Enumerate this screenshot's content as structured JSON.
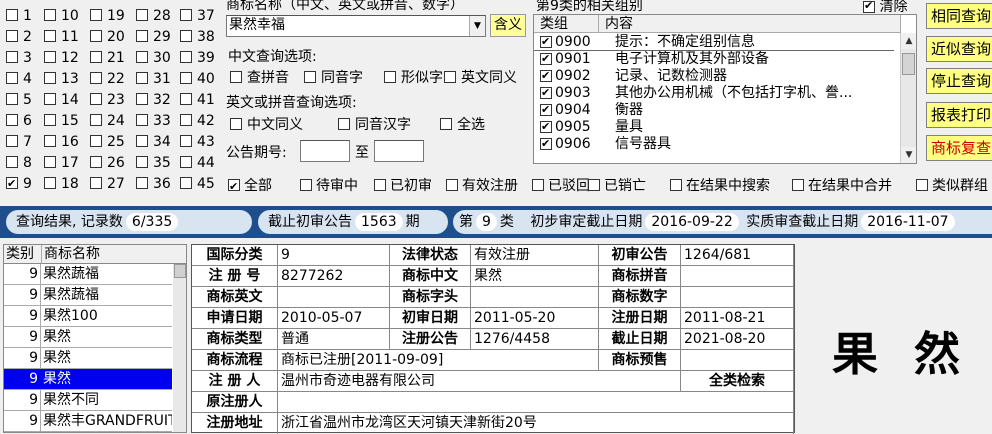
{
  "class_grid": {
    "columns": [
      [
        {
          "n": "1",
          "c": false
        },
        {
          "n": "2",
          "c": false
        },
        {
          "n": "3",
          "c": false
        },
        {
          "n": "4",
          "c": false
        },
        {
          "n": "5",
          "c": false
        },
        {
          "n": "6",
          "c": false
        },
        {
          "n": "7",
          "c": false
        },
        {
          "n": "8",
          "c": false
        },
        {
          "n": "9",
          "c": true
        }
      ],
      [
        {
          "n": "10",
          "c": false
        },
        {
          "n": "11",
          "c": false
        },
        {
          "n": "12",
          "c": false
        },
        {
          "n": "13",
          "c": false
        },
        {
          "n": "14",
          "c": false
        },
        {
          "n": "15",
          "c": false
        },
        {
          "n": "16",
          "c": false
        },
        {
          "n": "17",
          "c": false
        },
        {
          "n": "18",
          "c": false
        }
      ],
      [
        {
          "n": "19",
          "c": false
        },
        {
          "n": "20",
          "c": false
        },
        {
          "n": "21",
          "c": false
        },
        {
          "n": "22",
          "c": false
        },
        {
          "n": "23",
          "c": false
        },
        {
          "n": "24",
          "c": false
        },
        {
          "n": "25",
          "c": false
        },
        {
          "n": "26",
          "c": false
        },
        {
          "n": "27",
          "c": false
        }
      ],
      [
        {
          "n": "28",
          "c": false
        },
        {
          "n": "29",
          "c": false
        },
        {
          "n": "30",
          "c": false
        },
        {
          "n": "31",
          "c": false
        },
        {
          "n": "32",
          "c": false
        },
        {
          "n": "33",
          "c": false
        },
        {
          "n": "34",
          "c": false
        },
        {
          "n": "35",
          "c": false
        },
        {
          "n": "36",
          "c": false
        }
      ],
      [
        {
          "n": "37",
          "c": false
        },
        {
          "n": "38",
          "c": false
        },
        {
          "n": "39",
          "c": false
        },
        {
          "n": "40",
          "c": false
        },
        {
          "n": "41",
          "c": false
        },
        {
          "n": "42",
          "c": false
        },
        {
          "n": "43",
          "c": false
        },
        {
          "n": "44",
          "c": false
        },
        {
          "n": "45",
          "c": false
        }
      ]
    ]
  },
  "search": {
    "title": "商标名称（中文、英文或拼音、数字）",
    "name_value": "果然幸福",
    "meaning_button": "含义",
    "cn_options_title": "中文查询选项:",
    "cn_options": [
      "查拼音",
      "同音字",
      "形似字",
      "英文同义"
    ],
    "en_options_title": "英文或拼音查询选项:",
    "en_options": [
      "中文同义",
      "同音汉字",
      "全选"
    ],
    "issue_label": "公告期号:",
    "issue_to": "至",
    "issue_from_value": "",
    "issue_to_value": ""
  },
  "groups": {
    "title": "第9类的相关组别",
    "clear_label": "清除",
    "clear_checked": true,
    "col_group": "类组",
    "col_content": "内容",
    "rows": [
      {
        "code": "0900",
        "text": "提示：不确定组别信息",
        "c": true
      },
      {
        "code": "0901",
        "text": "电子计算机及其外部设备",
        "c": true
      },
      {
        "code": "0902",
        "text": "记录、记数检测器",
        "c": true
      },
      {
        "code": "0903",
        "text": "其他办公用机械（不包括打字机、誊...",
        "c": true
      },
      {
        "code": "0904",
        "text": "衡器",
        "c": true
      },
      {
        "code": "0905",
        "text": "量具",
        "c": true
      },
      {
        "code": "0906",
        "text": "信号器具",
        "c": true
      }
    ]
  },
  "right_buttons": [
    {
      "label": "相同查询",
      "color": "#000000"
    },
    {
      "label": "近似查询",
      "color": "#000000"
    },
    {
      "label": "停止查询",
      "color": "#000000"
    },
    {
      "label": "报表打印",
      "color": "#000000"
    },
    {
      "label": "商标复查",
      "color": "#cc0000"
    }
  ],
  "filters": [
    {
      "label": "全部",
      "c": true
    },
    {
      "label": "待审中",
      "c": false
    },
    {
      "label": "已初审",
      "c": false
    },
    {
      "label": "有效注册",
      "c": false
    },
    {
      "label": "已驳回",
      "c": false
    },
    {
      "label": "已销亡",
      "c": false
    },
    {
      "label": "在结果中搜索",
      "c": false
    },
    {
      "label": "在结果中合并",
      "c": false
    },
    {
      "label": "类似群组",
      "c": false
    }
  ],
  "status": {
    "result_label": "查询结果, 记录数",
    "result_value": "6/335",
    "cutoff_label": "截止初审公告",
    "cutoff_value": "1563",
    "cutoff_unit": "期",
    "class_label": "第",
    "class_value": "9",
    "class_unit": "类",
    "prelim_label": "初步审定截止日期",
    "prelim_value": "2016-09-22",
    "actual_label": "实质审查截止日期",
    "actual_value": "2016-11-07"
  },
  "results": {
    "col_class": "类别",
    "col_name": "商标名称",
    "rows": [
      {
        "cls": "9",
        "name": "果然蔬福",
        "sel": false
      },
      {
        "cls": "9",
        "name": "果然蔬福",
        "sel": false
      },
      {
        "cls": "9",
        "name": "果然100",
        "sel": false
      },
      {
        "cls": "9",
        "name": "果然",
        "sel": false
      },
      {
        "cls": "9",
        "name": "果然",
        "sel": false
      },
      {
        "cls": "9",
        "name": "果然",
        "sel": true
      },
      {
        "cls": "9",
        "name": "果然不同",
        "sel": false
      },
      {
        "cls": "9",
        "name": "果然丰GRANDFRUIT",
        "sel": false
      }
    ]
  },
  "detail": {
    "intl_class_k": "国际分类",
    "intl_class_v": "9",
    "legal_status_k": "法律状态",
    "legal_status_v": "有效注册",
    "prelim_k": "初审公告",
    "prelim_v": "1264/681",
    "reg_no_k": "注 册 号",
    "reg_no_v": "8277262",
    "cn_name_k": "商标中文",
    "cn_name_v": "果然",
    "pinyin_k": "商标拼音",
    "pinyin_v": "",
    "en_name_k": "商标英文",
    "en_name_v": "",
    "head_k": "商标字头",
    "head_v": "",
    "digit_k": "商标数字",
    "digit_v": "",
    "apply_date_k": "申请日期",
    "apply_date_v": "2010-05-07",
    "prelim_date_k": "初审日期",
    "prelim_date_v": "2011-05-20",
    "reg_date_k": "注册日期",
    "reg_date_v": "2011-08-21",
    "type_k": "商标类型",
    "type_v": "普通",
    "reg_notice_k": "注册公告",
    "reg_notice_v": "1276/4458",
    "expiry_k": "截止日期",
    "expiry_v": "2021-08-20",
    "flow_k": "商标流程",
    "flow_v": "商标已注册[2011-09-09]",
    "warn_k": "商标预售",
    "warn_v": "",
    "registrant_k": "注 册 人",
    "registrant_v": "温州市奇迹电器有限公司",
    "full_search": "全类检索",
    "orig_registrant_k": "原注册人",
    "orig_registrant_v": "",
    "address_k": "注册地址",
    "address_v": "浙江省温州市龙湾区天河镇天津新街20号"
  },
  "big_name": "果 然"
}
